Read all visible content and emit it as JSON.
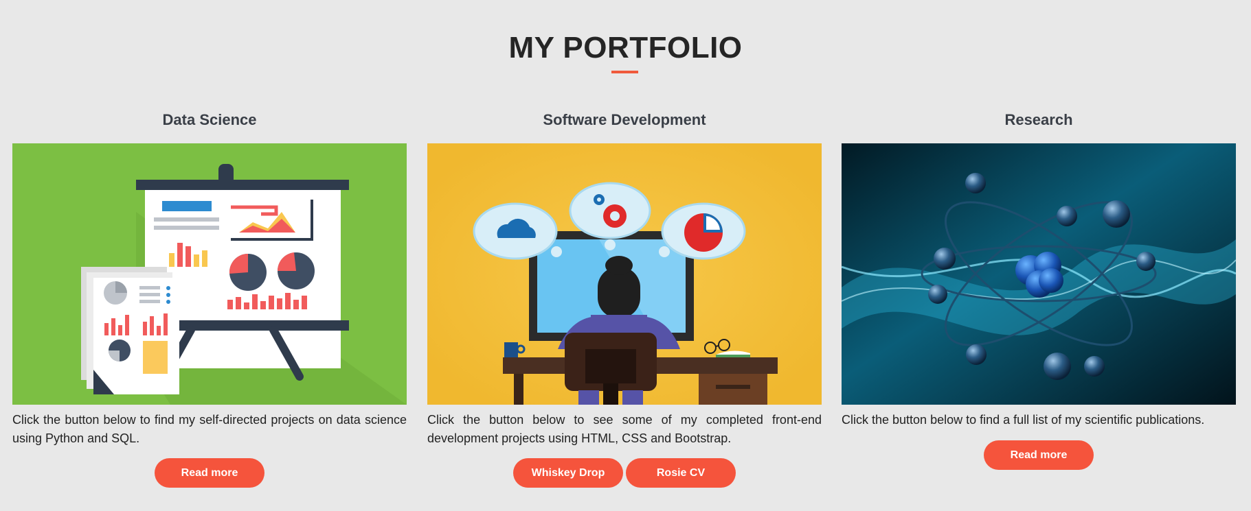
{
  "page": {
    "title": "MY PORTFOLIO"
  },
  "colors": {
    "accent": "#f5543c",
    "background": "#e8e8e8"
  },
  "cards": [
    {
      "title": "Data Science",
      "image": "presentation-board-illustration",
      "description": "Click the button below to find my self-directed projects on data science using Python and SQL.",
      "buttons": [
        "Read more"
      ]
    },
    {
      "title": "Software Development",
      "image": "developer-at-desk-illustration",
      "description": "Click the button below to see some of my completed front-end development projects using HTML, CSS and Bootstrap.",
      "buttons": [
        "Whiskey Drop",
        "Rosie CV"
      ]
    },
    {
      "title": "Research",
      "image": "atom-molecule-illustration",
      "description": "Click the button below to find a full list of my scientific publications.",
      "buttons": [
        "Read more"
      ]
    }
  ]
}
